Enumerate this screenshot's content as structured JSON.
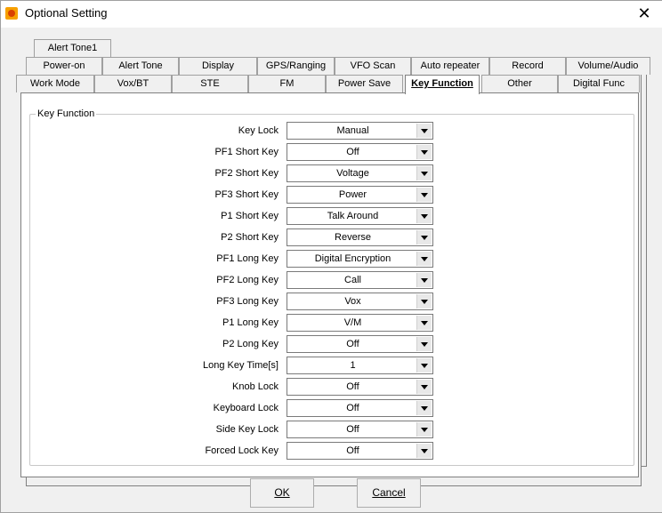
{
  "window": {
    "title": "Optional Setting"
  },
  "tabs": {
    "row1": [
      {
        "label": "Alert Tone1"
      }
    ],
    "row2": [
      {
        "label": "Power-on"
      },
      {
        "label": "Alert Tone"
      },
      {
        "label": "Display"
      },
      {
        "label": "GPS/Ranging"
      },
      {
        "label": "VFO Scan"
      },
      {
        "label": "Auto repeater"
      },
      {
        "label": "Record"
      },
      {
        "label": "Volume/Audio"
      }
    ],
    "row3": [
      {
        "label": "Work Mode"
      },
      {
        "label": "Vox/BT"
      },
      {
        "label": "STE"
      },
      {
        "label": "FM"
      },
      {
        "label": "Power Save"
      },
      {
        "label": "Key Function"
      },
      {
        "label": "Other"
      },
      {
        "label": "Digital Func"
      }
    ],
    "active": "Key Function"
  },
  "group": {
    "title": "Key Function"
  },
  "settings": [
    {
      "label": "Key Lock",
      "value": "Manual"
    },
    {
      "label": "PF1 Short Key",
      "value": "Off"
    },
    {
      "label": "PF2 Short Key",
      "value": "Voltage"
    },
    {
      "label": "PF3 Short Key",
      "value": "Power"
    },
    {
      "label": "P1 Short Key",
      "value": "Talk Around"
    },
    {
      "label": "P2 Short Key",
      "value": "Reverse"
    },
    {
      "label": "PF1 Long Key",
      "value": "Digital Encryption"
    },
    {
      "label": "PF2 Long Key",
      "value": "Call"
    },
    {
      "label": "PF3 Long Key",
      "value": "Vox"
    },
    {
      "label": "P1 Long Key",
      "value": "V/M"
    },
    {
      "label": "P2 Long Key",
      "value": "Off"
    },
    {
      "label": "Long Key Time[s]",
      "value": "1"
    },
    {
      "label": "Knob Lock",
      "value": "Off"
    },
    {
      "label": "Keyboard Lock",
      "value": "Off"
    },
    {
      "label": "Side Key Lock",
      "value": "Off"
    },
    {
      "label": "Forced Lock Key",
      "value": "Off"
    }
  ],
  "buttons": {
    "ok": "OK",
    "cancel": "Cancel"
  }
}
